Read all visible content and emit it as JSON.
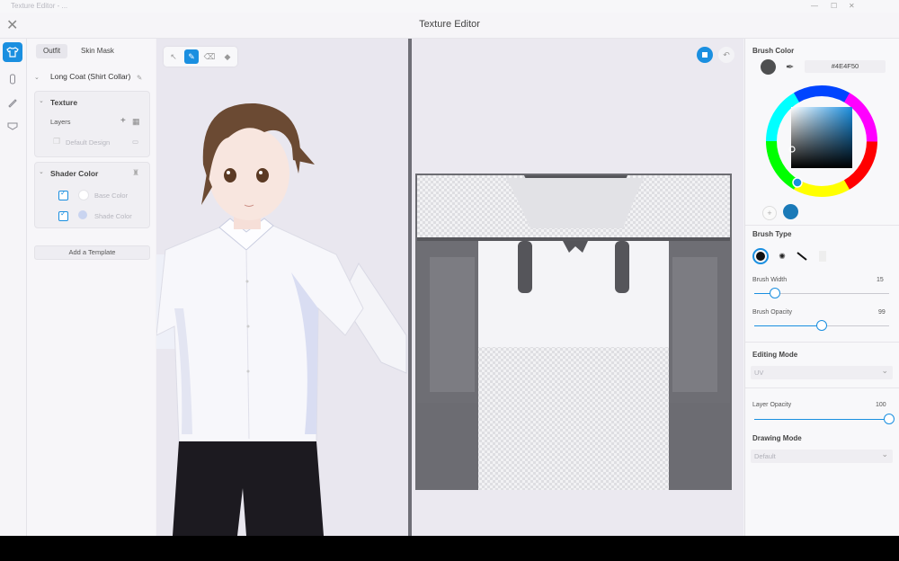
{
  "window": {
    "os_title": "Texture Editor - ...",
    "title": "Texture Editor"
  },
  "sidebar": {
    "tabs": [
      "Outfit",
      "Skin Mask"
    ],
    "garment": "Long Coat (Shirt Collar)",
    "texture": {
      "title": "Texture",
      "layers_label": "Layers",
      "layer_name": "Default Design"
    },
    "shader": {
      "title": "Shader Color",
      "base_color": "Base Color",
      "shade_color": "Shade Color"
    },
    "add_template": "Add a Template"
  },
  "brush_color": {
    "label": "Brush Color",
    "hex": "#4E4F50",
    "value": "#4E4F50",
    "recent": "#1a7ab8"
  },
  "brush_type": {
    "label": "Brush Type"
  },
  "brush_width": {
    "label": "Brush Width",
    "value": "15",
    "level": 0.15
  },
  "brush_opacity": {
    "label": "Brush Opacity",
    "value": "99",
    "level": 0.5
  },
  "editing_mode": {
    "label": "Editing Mode",
    "value": "UV"
  },
  "layer_opacity": {
    "label": "Layer Opacity",
    "value": "100",
    "level": 1.0
  },
  "drawing_mode": {
    "label": "Drawing Mode",
    "value": "Default"
  },
  "colors": {
    "accent": "#1a8fe0"
  }
}
